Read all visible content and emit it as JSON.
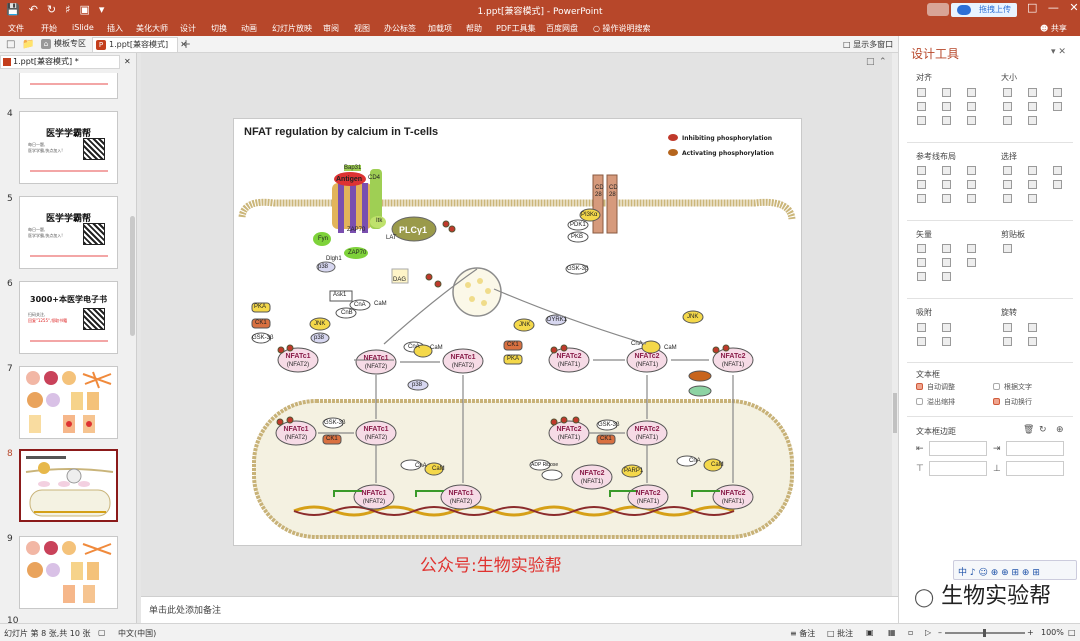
{
  "titlebar": {
    "document_title": "1.ppt[兼容模式] - PowerPoint",
    "upload_label": "拖拽上传",
    "share_label": "共享"
  },
  "ribbon_tabs": [
    "文件",
    "开始",
    "iSlide",
    "插入",
    "美化大师",
    "设计",
    "切换",
    "动画",
    "幻灯片放映",
    "审阅",
    "视图",
    "办公标签",
    "加载项",
    "帮助",
    "PDF工具集",
    "百度网盘",
    "操作说明搜索"
  ],
  "doc_tabs": {
    "template_label": "模板专区",
    "active_label": "1.ppt[兼容模式]",
    "multi_window_label": "显示多窗口",
    "file_label": "1.ppt[兼容模式] *"
  },
  "thumbnails": [
    {
      "num": "4",
      "title": "医学学霸帮",
      "sub1": "每日一题,",
      "sub2": "医学学霸,快点加入!"
    },
    {
      "num": "5",
      "title": "医学学霸帮",
      "sub1": "每日一题,",
      "sub2": "医学学霸,快点加入!"
    },
    {
      "num": "6",
      "title": "3000+本医学电子书",
      "sub1": "扫码关注,",
      "sub2": "回复\"1255\",领取书籍"
    },
    {
      "num": "7"
    },
    {
      "num": "8"
    },
    {
      "num": "9"
    },
    {
      "num": "10"
    }
  ],
  "slide": {
    "title": "NFAT regulation by calcium in T-cells",
    "legend_inhibiting": "Inhibiting phosphorylation",
    "legend_activating": "Activating phosphorylation",
    "legend_inhibiting_color": "#c0392b",
    "legend_activating_color": "#b5651d",
    "labels": {
      "antigen": "Antigen",
      "cd4": "CD4",
      "bap31": "Bap31",
      "plc": "PLCγ1",
      "dag": "DAG",
      "cd28": "CD 28",
      "pi3k": "PI3Kα",
      "pdk1": "PDK1",
      "pkb": "PKB",
      "gsk": "GSK-3β",
      "nfatc1": "NFATc1",
      "nfat2": "(NFAT2)",
      "nfatc2": "NFATc2",
      "nfat1": "(NFAT1)",
      "cna": "CnA",
      "cnb": "CnB",
      "cam": "CaM",
      "jnk": "JNK",
      "p38": "p38",
      "pka": "PKA",
      "ck1": "CK1",
      "dyrk1": "DYRK1",
      "ask1": "Ask1",
      "itk": "Itk",
      "zap70": "ZAP70",
      "fyn": "Fyn",
      "lck": "Lck",
      "dlgh1": "Dlgh1",
      "lat": "LAT",
      "parp1": "PARP1",
      "adp": "ADP Ribose"
    }
  },
  "caption": "公众号:生物实验帮",
  "notes_placeholder": "单击此处添加备注",
  "design_pane": {
    "title": "设计工具",
    "sections": {
      "align": "对齐",
      "size": "大小",
      "guides": "参考线布局",
      "select": "选择",
      "arrow": "矢量",
      "clip": "剪贴板",
      "snap": "吸附",
      "rotate": "旋转",
      "textbox": "文本框",
      "margins": "文本框边距"
    },
    "options": {
      "autofit": "自动调整",
      "overflow": "溢出缩排",
      "by_text": "根据文字",
      "wrap": "自动换行"
    }
  },
  "watermark_text": "中 ♪ ☺ ⊕ ⊕ ⊞ ⊕ ⊞",
  "brand_text": "生物实验帮",
  "status": {
    "slide_pos": "幻灯片 第 8 张,共 10 张",
    "language": "中文(中国)",
    "notes": "备注",
    "comments": "批注",
    "zoom": "100%"
  }
}
